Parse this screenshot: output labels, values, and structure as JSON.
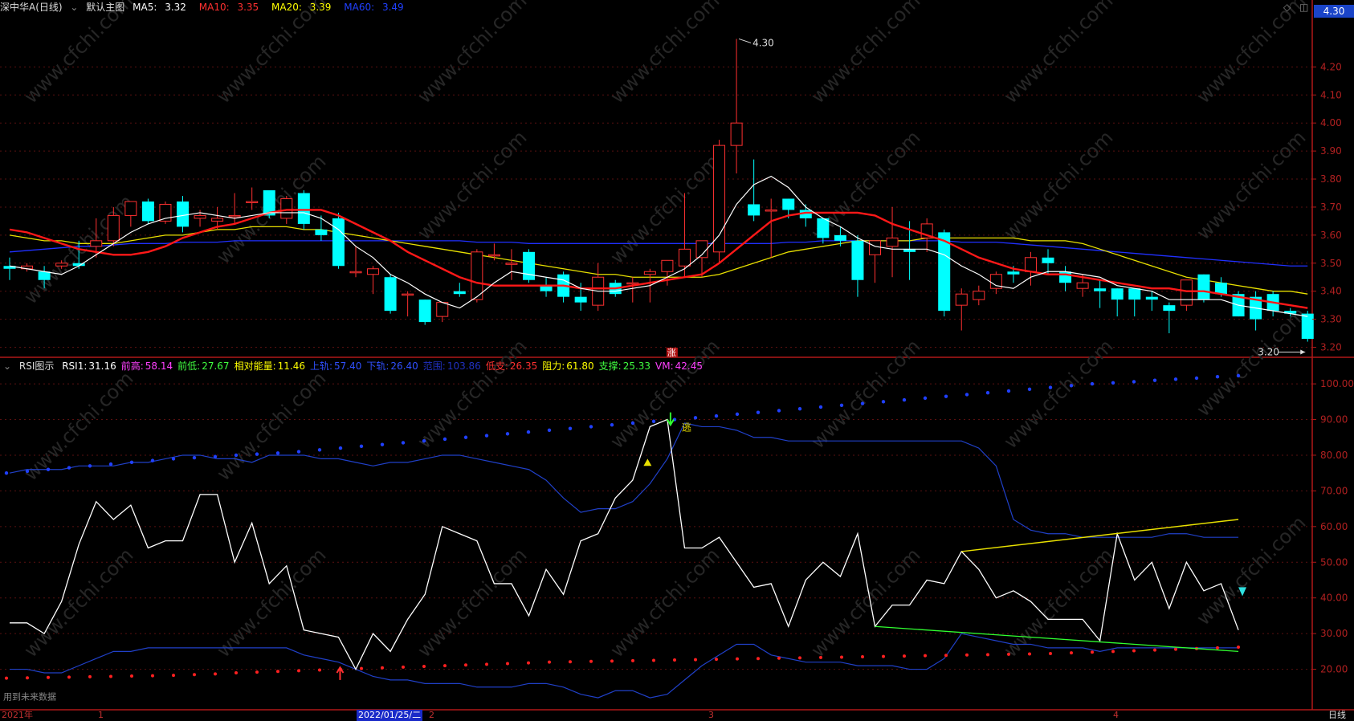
{
  "main_header": {
    "stock_name": "深中华A(日线)",
    "main_chart_name": "默认主图",
    "ma5": {
      "label": "MA5:",
      "value": "3.32",
      "color": "#ffffff"
    },
    "ma10": {
      "label": "MA10:",
      "value": "3.35",
      "color": "#ff3030"
    },
    "ma20": {
      "label": "MA20:",
      "value": "3.39",
      "color": "#ffff00"
    },
    "ma60": {
      "label": "MA60:",
      "value": "3.49",
      "color": "#2040ff"
    }
  },
  "current_price_tag": "4.30",
  "sub_header": {
    "name": "RSI图示",
    "items": [
      {
        "label": "RSI1:",
        "value": "31.16",
        "color": "#ffffff"
      },
      {
        "label": "前高:",
        "value": "58.14",
        "color": "#ff40ff"
      },
      {
        "label": "前低:",
        "value": "27.67",
        "color": "#40ff40"
      },
      {
        "label": "相对能量:",
        "value": "11.46",
        "color": "#ffff00"
      },
      {
        "label": "上轨:",
        "value": "57.40",
        "color": "#3050ff"
      },
      {
        "label": "下轨:",
        "value": "26.40",
        "color": "#3050ff"
      },
      {
        "label": "范围:",
        "value": "103.86",
        "color": "#2030c0"
      },
      {
        "label": "低支:",
        "value": "26.35",
        "color": "#ff3030"
      },
      {
        "label": "阻力:",
        "value": "61.80",
        "color": "#ffff00"
      },
      {
        "label": "支撑:",
        "value": "25.33",
        "color": "#40ff40"
      },
      {
        "label": "VM:",
        "value": "42.45",
        "color": "#ff40ff"
      }
    ]
  },
  "annotations": {
    "high_label": "4.30",
    "low_label": "3.20",
    "zhang": "涨",
    "tao": "逃",
    "future_data": "用到未来数据"
  },
  "footer": {
    "labels": [
      "2021年",
      "1",
      "2022/01/25/二",
      "2",
      "3",
      "4"
    ],
    "period": "日线"
  },
  "watermark": "www.cfchi.com",
  "chart_data": [
    {
      "type": "candlestick",
      "title": "深中华A(日线)",
      "ylim": [
        3.17,
        4.37
      ],
      "yticks": [
        3.2,
        3.3,
        3.4,
        3.5,
        3.6,
        3.7,
        3.8,
        3.9,
        4.0,
        4.1,
        4.2
      ],
      "candles": [
        [
          3.49,
          3.52,
          3.44,
          3.48
        ],
        [
          3.48,
          3.5,
          3.47,
          3.49
        ],
        [
          3.47,
          3.49,
          3.41,
          3.44
        ],
        [
          3.49,
          3.51,
          3.48,
          3.5
        ],
        [
          3.5,
          3.58,
          3.48,
          3.49
        ],
        [
          3.56,
          3.66,
          3.52,
          3.58
        ],
        [
          3.58,
          3.7,
          3.56,
          3.67
        ],
        [
          3.67,
          3.72,
          3.63,
          3.72
        ],
        [
          3.72,
          3.73,
          3.64,
          3.65
        ],
        [
          3.65,
          3.72,
          3.64,
          3.71
        ],
        [
          3.72,
          3.74,
          3.61,
          3.63
        ],
        [
          3.66,
          3.69,
          3.63,
          3.67
        ],
        [
          3.65,
          3.7,
          3.62,
          3.66
        ],
        [
          3.67,
          3.75,
          3.64,
          3.67
        ],
        [
          3.72,
          3.77,
          3.69,
          3.72
        ],
        [
          3.76,
          3.76,
          3.66,
          3.67
        ],
        [
          3.66,
          3.74,
          3.64,
          3.73
        ],
        [
          3.75,
          3.76,
          3.62,
          3.64
        ],
        [
          3.62,
          3.67,
          3.58,
          3.6
        ],
        [
          3.66,
          3.68,
          3.48,
          3.49
        ],
        [
          3.47,
          3.56,
          3.45,
          3.47
        ],
        [
          3.46,
          3.49,
          3.39,
          3.48
        ],
        [
          3.45,
          3.46,
          3.32,
          3.33
        ],
        [
          3.39,
          3.4,
          3.31,
          3.39
        ],
        [
          3.37,
          3.37,
          3.28,
          3.29
        ],
        [
          3.31,
          3.34,
          3.29,
          3.36
        ],
        [
          3.4,
          3.43,
          3.38,
          3.39
        ],
        [
          3.37,
          3.55,
          3.36,
          3.54
        ],
        [
          3.53,
          3.57,
          3.51,
          3.53
        ],
        [
          3.5,
          3.55,
          3.44,
          3.5
        ],
        [
          3.54,
          3.55,
          3.43,
          3.44
        ],
        [
          3.42,
          3.45,
          3.38,
          3.4
        ],
        [
          3.46,
          3.47,
          3.36,
          3.38
        ],
        [
          3.38,
          3.43,
          3.33,
          3.36
        ],
        [
          3.35,
          3.5,
          3.33,
          3.45
        ],
        [
          3.43,
          3.44,
          3.38,
          3.39
        ],
        [
          3.43,
          3.45,
          3.36,
          3.43
        ],
        [
          3.46,
          3.48,
          3.36,
          3.47
        ],
        [
          3.47,
          3.5,
          3.42,
          3.51
        ],
        [
          3.49,
          3.75,
          3.45,
          3.55
        ],
        [
          3.52,
          3.58,
          3.45,
          3.58
        ],
        [
          3.54,
          3.94,
          3.5,
          3.92
        ],
        [
          3.92,
          4.3,
          3.82,
          4.0
        ],
        [
          3.71,
          3.87,
          3.65,
          3.67
        ],
        [
          3.69,
          3.73,
          3.52,
          3.69
        ],
        [
          3.73,
          3.73,
          3.66,
          3.69
        ],
        [
          3.69,
          3.71,
          3.63,
          3.66
        ],
        [
          3.66,
          3.66,
          3.57,
          3.59
        ],
        [
          3.6,
          3.63,
          3.56,
          3.58
        ],
        [
          3.58,
          3.6,
          3.38,
          3.44
        ],
        [
          3.53,
          3.58,
          3.43,
          3.58
        ],
        [
          3.56,
          3.7,
          3.45,
          3.59
        ],
        [
          3.55,
          3.65,
          3.44,
          3.54
        ],
        [
          3.59,
          3.66,
          3.54,
          3.64
        ],
        [
          3.61,
          3.62,
          3.31,
          3.33
        ],
        [
          3.35,
          3.41,
          3.26,
          3.39
        ],
        [
          3.37,
          3.42,
          3.35,
          3.4
        ],
        [
          3.41,
          3.47,
          3.39,
          3.46
        ],
        [
          3.47,
          3.49,
          3.43,
          3.46
        ],
        [
          3.47,
          3.54,
          3.42,
          3.52
        ],
        [
          3.52,
          3.55,
          3.46,
          3.5
        ],
        [
          3.47,
          3.49,
          3.4,
          3.43
        ],
        [
          3.41,
          3.46,
          3.38,
          3.43
        ],
        [
          3.41,
          3.44,
          3.34,
          3.4
        ],
        [
          3.41,
          3.41,
          3.31,
          3.37
        ],
        [
          3.41,
          3.41,
          3.31,
          3.37
        ],
        [
          3.38,
          3.4,
          3.33,
          3.37
        ],
        [
          3.35,
          3.36,
          3.25,
          3.33
        ],
        [
          3.35,
          3.44,
          3.33,
          3.44
        ],
        [
          3.46,
          3.46,
          3.36,
          3.37
        ],
        [
          3.43,
          3.45,
          3.38,
          3.39
        ],
        [
          3.39,
          3.4,
          3.31,
          3.31
        ],
        [
          3.38,
          3.4,
          3.26,
          3.3
        ],
        [
          3.39,
          3.4,
          3.31,
          3.33
        ],
        [
          3.33,
          3.34,
          3.31,
          3.32
        ],
        [
          3.32,
          3.33,
          3.22,
          3.23
        ]
      ],
      "ma5": [
        3.49,
        3.48,
        3.47,
        3.46,
        3.49,
        3.53,
        3.57,
        3.61,
        3.64,
        3.66,
        3.67,
        3.68,
        3.67,
        3.66,
        3.67,
        3.68,
        3.68,
        3.68,
        3.66,
        3.62,
        3.56,
        3.52,
        3.46,
        3.43,
        3.39,
        3.36,
        3.34,
        3.38,
        3.43,
        3.47,
        3.46,
        3.45,
        3.44,
        3.41,
        3.4,
        3.4,
        3.41,
        3.42,
        3.45,
        3.48,
        3.53,
        3.6,
        3.71,
        3.78,
        3.81,
        3.77,
        3.7,
        3.66,
        3.63,
        3.59,
        3.56,
        3.55,
        3.55,
        3.55,
        3.53,
        3.49,
        3.46,
        3.42,
        3.41,
        3.45,
        3.47,
        3.47,
        3.46,
        3.45,
        3.42,
        3.41,
        3.4,
        3.37,
        3.37,
        3.37,
        3.37,
        3.35,
        3.34,
        3.33,
        3.32,
        3.31
      ],
      "ma10": [
        3.62,
        3.61,
        3.59,
        3.57,
        3.55,
        3.54,
        3.53,
        3.53,
        3.54,
        3.56,
        3.59,
        3.61,
        3.63,
        3.64,
        3.66,
        3.68,
        3.69,
        3.69,
        3.69,
        3.67,
        3.64,
        3.61,
        3.58,
        3.54,
        3.51,
        3.48,
        3.45,
        3.43,
        3.42,
        3.42,
        3.42,
        3.42,
        3.42,
        3.41,
        3.41,
        3.41,
        3.42,
        3.43,
        3.44,
        3.45,
        3.46,
        3.5,
        3.55,
        3.6,
        3.65,
        3.67,
        3.68,
        3.68,
        3.68,
        3.68,
        3.67,
        3.64,
        3.62,
        3.6,
        3.58,
        3.55,
        3.52,
        3.5,
        3.48,
        3.47,
        3.46,
        3.46,
        3.45,
        3.44,
        3.43,
        3.42,
        3.41,
        3.41,
        3.4,
        3.4,
        3.39,
        3.38,
        3.37,
        3.36,
        3.35,
        3.34
      ],
      "ma20": [
        3.6,
        3.59,
        3.58,
        3.58,
        3.57,
        3.57,
        3.57,
        3.58,
        3.59,
        3.6,
        3.6,
        3.61,
        3.62,
        3.62,
        3.63,
        3.63,
        3.63,
        3.62,
        3.62,
        3.61,
        3.6,
        3.59,
        3.58,
        3.57,
        3.56,
        3.55,
        3.54,
        3.53,
        3.52,
        3.51,
        3.5,
        3.49,
        3.48,
        3.47,
        3.46,
        3.46,
        3.45,
        3.45,
        3.45,
        3.45,
        3.45,
        3.46,
        3.48,
        3.5,
        3.52,
        3.54,
        3.55,
        3.56,
        3.57,
        3.58,
        3.58,
        3.58,
        3.58,
        3.59,
        3.59,
        3.59,
        3.59,
        3.59,
        3.59,
        3.58,
        3.58,
        3.58,
        3.57,
        3.55,
        3.53,
        3.51,
        3.49,
        3.47,
        3.45,
        3.44,
        3.43,
        3.42,
        3.41,
        3.4,
        3.4,
        3.39
      ],
      "ma60": [
        3.54,
        3.545,
        3.55,
        3.555,
        3.56,
        3.56,
        3.565,
        3.57,
        3.57,
        3.57,
        3.575,
        3.575,
        3.575,
        3.58,
        3.58,
        3.58,
        3.58,
        3.58,
        3.58,
        3.58,
        3.58,
        3.58,
        3.58,
        3.58,
        3.58,
        3.58,
        3.58,
        3.575,
        3.575,
        3.575,
        3.57,
        3.57,
        3.57,
        3.57,
        3.57,
        3.57,
        3.57,
        3.57,
        3.57,
        3.57,
        3.57,
        3.57,
        3.57,
        3.57,
        3.57,
        3.575,
        3.575,
        3.58,
        3.58,
        3.58,
        3.58,
        3.58,
        3.58,
        3.58,
        3.58,
        3.575,
        3.575,
        3.575,
        3.57,
        3.565,
        3.56,
        3.555,
        3.55,
        3.545,
        3.54,
        3.535,
        3.53,
        3.525,
        3.52,
        3.515,
        3.51,
        3.505,
        3.5,
        3.495,
        3.49,
        3.49
      ]
    },
    {
      "type": "line",
      "title": "RSI图示",
      "ylim": [
        10,
        107
      ],
      "yticks": [
        20,
        30,
        40,
        50,
        60,
        70,
        80,
        90,
        100
      ],
      "rsi": [
        33,
        33,
        30,
        39,
        55,
        67,
        62,
        66,
        54,
        56,
        56,
        69,
        69,
        50,
        61,
        44,
        49,
        31,
        30,
        29,
        20,
        30,
        25,
        34,
        41,
        60,
        58,
        56,
        44,
        44,
        35,
        48,
        41,
        56,
        58,
        68,
        73,
        88,
        90,
        54,
        54,
        57,
        50,
        43,
        44,
        32,
        45,
        50,
        46,
        58,
        32,
        38,
        38,
        45,
        44,
        53,
        48,
        40,
        42,
        39,
        34,
        34,
        34,
        28,
        58,
        45,
        50,
        37,
        50,
        42,
        44,
        31
      ],
      "upper_band": [
        75,
        76,
        76,
        76,
        77,
        77,
        77,
        78,
        78,
        79,
        80,
        80,
        79,
        79,
        78,
        80,
        80,
        80,
        79,
        79,
        78,
        77,
        78,
        78,
        79,
        80,
        80,
        79,
        78,
        77,
        76,
        73,
        68,
        64,
        65,
        65,
        67,
        72,
        79,
        89,
        88,
        88,
        87,
        85,
        85,
        84,
        84,
        84,
        84,
        84,
        84,
        84,
        84,
        84,
        84,
        84,
        82,
        77,
        62,
        59,
        58,
        58,
        57,
        57,
        57,
        57,
        57,
        58,
        58,
        57,
        57,
        57
      ],
      "lower_band": [
        20,
        20,
        19,
        19,
        21,
        23,
        25,
        25,
        26,
        26,
        26,
        26,
        26,
        26,
        26,
        26,
        26,
        24,
        23,
        22,
        20,
        18,
        17,
        17,
        16,
        16,
        16,
        15,
        15,
        15,
        16,
        16,
        15,
        13,
        12,
        14,
        14,
        12,
        13,
        17,
        21,
        24,
        27,
        27,
        24,
        23,
        22,
        22,
        22,
        21,
        21,
        21,
        20,
        20,
        23,
        30,
        29,
        28,
        27,
        27,
        26,
        26,
        26,
        25,
        26,
        26,
        26,
        26,
        26,
        26,
        26,
        26
      ],
      "upper_dots": [
        75,
        75.5,
        76,
        76.5,
        77,
        77.5,
        78,
        78.5,
        79,
        79.3,
        79.6,
        80,
        80.3,
        80.6,
        81,
        81.5,
        82,
        82.5,
        83,
        83.5,
        84,
        84.5,
        85,
        85.5,
        86,
        86.5,
        87,
        87.5,
        88,
        88.5,
        89,
        89.5,
        90,
        90.5,
        91,
        91.5,
        92,
        92.5,
        93,
        93.5,
        94,
        94.5,
        95,
        95.5,
        96,
        96.5,
        97,
        97.5,
        98,
        98.5,
        99,
        99.5,
        100,
        100.3,
        100.6,
        101,
        101.3,
        101.6,
        102,
        102.3
      ],
      "lower_dots": [
        17.5,
        17.6,
        17.7,
        17.8,
        17.9,
        18,
        18.1,
        18.2,
        18.3,
        18.5,
        18.7,
        19,
        19.2,
        19.4,
        19.6,
        19.8,
        20,
        20.2,
        20.4,
        20.6,
        20.8,
        21,
        21.2,
        21.4,
        21.6,
        21.8,
        22,
        22.1,
        22.2,
        22.3,
        22.4,
        22.5,
        22.6,
        22.7,
        22.8,
        22.9,
        23,
        23.1,
        23.2,
        23.3,
        23.4,
        23.5,
        23.6,
        23.7,
        23.8,
        23.9,
        24,
        24.1,
        24.2,
        24.3,
        24.4,
        24.6,
        24.8,
        25,
        25.2,
        25.4,
        25.6,
        25.8,
        26,
        26.2
      ],
      "resistance_line": {
        "from": [
          55,
          53
        ],
        "to": [
          71,
          62
        ]
      },
      "support_line": {
        "from": [
          50,
          32
        ],
        "to": [
          71,
          25
        ]
      }
    }
  ]
}
